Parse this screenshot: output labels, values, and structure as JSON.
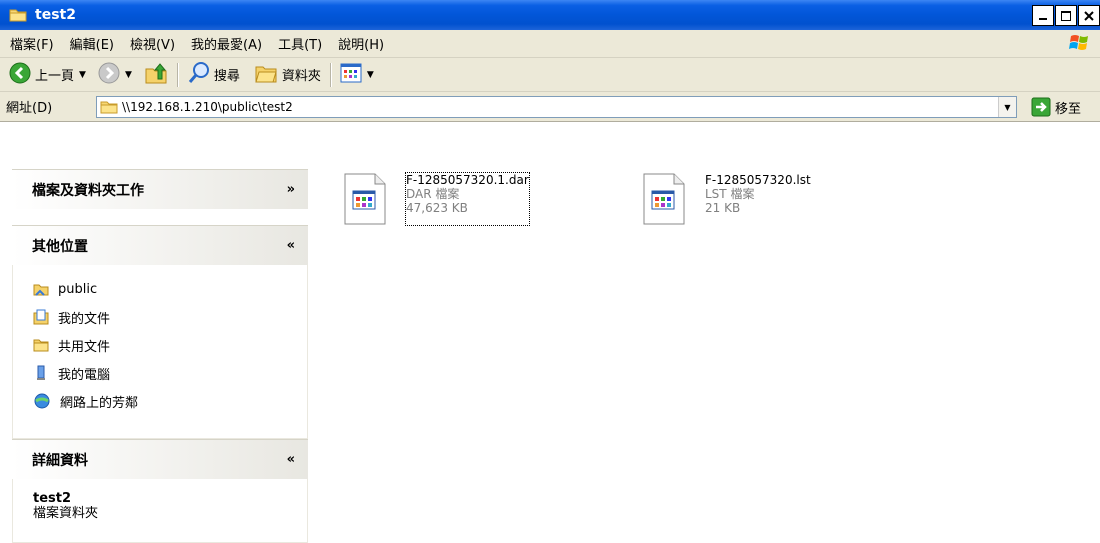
{
  "window": {
    "title": "test2"
  },
  "menu": {
    "items": [
      "檔案(F)",
      "編輯(E)",
      "檢視(V)",
      "我的最愛(A)",
      "工具(T)",
      "說明(H)"
    ]
  },
  "toolbar": {
    "back": "上一頁",
    "search": "搜尋",
    "folders": "資料夾"
  },
  "address": {
    "label": "網址(D)",
    "path": "\\\\192.168.1.210\\public\\test2",
    "go": "移至"
  },
  "tasks": {
    "file_tasks": {
      "title": "檔案及資料夾工作"
    },
    "other_places": {
      "title": "其他位置",
      "items": [
        "public",
        "我的文件",
        "共用文件",
        "我的電腦",
        "網路上的芳鄰"
      ]
    },
    "details": {
      "title": "詳細資料",
      "name": "test2",
      "type": "檔案資料夾"
    }
  },
  "files": [
    {
      "name": "F-1285057320.1.dar",
      "type": "DAR 檔案",
      "size": "47,623 KB"
    },
    {
      "name": "F-1285057320.lst",
      "type": "LST 檔案",
      "size": "21 KB"
    }
  ]
}
